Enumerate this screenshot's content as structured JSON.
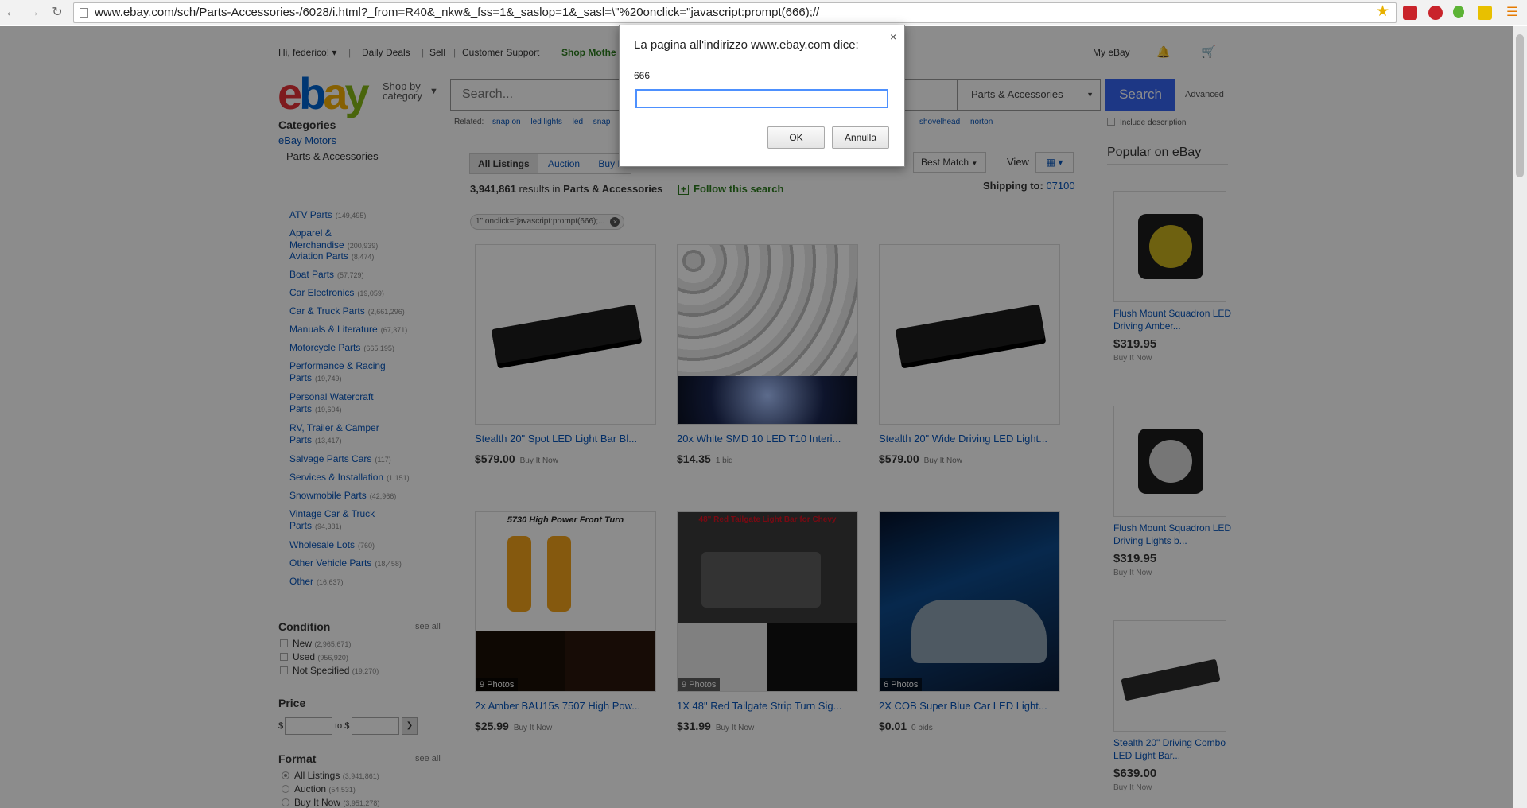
{
  "browser": {
    "url": "www.ebay.com/sch/Parts-Accessories-/6028/i.html?_from=R40&_nkw&_fss=1&_saslop=1&_sasl=\\\"%20onclick=\"javascript:prompt(666);//"
  },
  "header": {
    "greeting": "Hi, federico!",
    "daily_deals": "Daily Deals",
    "sell": "Sell",
    "customer_support": "Customer Support",
    "shop_mothers": "Shop Mothe",
    "my_ebay": "My eBay",
    "shop_by_category": "Shop by\ncategory",
    "search_placeholder": "Search...",
    "category_selected": "Parts & Accessories",
    "search_button": "Search",
    "advanced": "Advanced",
    "include_description": "Include description",
    "related_label": "Related:",
    "related": [
      "snap on",
      "led lights",
      "led",
      "snap"
    ],
    "related_right": [
      "shovelhead",
      "norton"
    ]
  },
  "sidebar": {
    "categories_heading": "Categories",
    "ebay_motors": "eBay Motors",
    "parts_accessories": "Parts & Accessories",
    "items": [
      {
        "label": "ATV Parts",
        "count": "(149,495)"
      },
      {
        "label": "Apparel &\nMerchandise",
        "count": "(200,939)"
      },
      {
        "label": "Aviation Parts",
        "count": "(8,474)"
      },
      {
        "label": "Boat Parts",
        "count": "(57,729)"
      },
      {
        "label": "Car Electronics",
        "count": "(19,059)"
      },
      {
        "label": "Car & Truck Parts",
        "count": "(2,661,296)"
      },
      {
        "label": "Manuals & Literature",
        "count": "(67,371)"
      },
      {
        "label": "Motorcycle Parts",
        "count": "(665,195)"
      },
      {
        "label": "Performance & Racing\nParts",
        "count": "(19,749)"
      },
      {
        "label": "Personal Watercraft\nParts",
        "count": "(19,604)"
      },
      {
        "label": "RV, Trailer & Camper\nParts",
        "count": "(13,417)"
      },
      {
        "label": "Salvage Parts Cars",
        "count": "(117)"
      },
      {
        "label": "Services & Installation",
        "count": "(1,151)"
      },
      {
        "label": "Snowmobile Parts",
        "count": "(42,966)"
      },
      {
        "label": "Vintage Car & Truck\nParts",
        "count": "(94,381)"
      },
      {
        "label": "Wholesale Lots",
        "count": "(760)"
      },
      {
        "label": "Other Vehicle Parts",
        "count": "(18,458)"
      },
      {
        "label": "Other",
        "count": "(16,637)"
      }
    ],
    "condition_heading": "Condition",
    "see_all": "see all",
    "conditions": [
      {
        "label": "New",
        "count": "(2,965,671)"
      },
      {
        "label": "Used",
        "count": "(956,920)"
      },
      {
        "label": "Not Specified",
        "count": "(19,270)"
      }
    ],
    "price_heading": "Price",
    "currency": "$",
    "to_label": "to $",
    "format_heading": "Format",
    "formats": [
      {
        "label": "All Listings",
        "count": "(3,941,861)"
      },
      {
        "label": "Auction",
        "count": "(54,531)"
      },
      {
        "label": "Buy It Now",
        "count": "(3,951,278)"
      }
    ]
  },
  "results": {
    "tabs": [
      "All Listings",
      "Auction",
      "Buy It"
    ],
    "sort": "Best Match",
    "view_label": "View",
    "count": "3,941,861",
    "results_in": "results in",
    "category": "Parts & Accessories",
    "follow": "Follow this search",
    "shipping_label": "Shipping to:",
    "shipping_zip": "07100",
    "filter_chip": "1\" onclick=\"javascript:prompt(666);...",
    "items": [
      {
        "title": "Stealth 20\" Spot LED Light Bar Bl...",
        "price": "$579.00",
        "sub": "Buy It Now",
        "photos": ""
      },
      {
        "title": "20x White SMD 10 LED T10 Interi...",
        "price": "$14.35",
        "sub": "1 bid",
        "photos": ""
      },
      {
        "title": "Stealth 20\" Wide Driving LED Light...",
        "price": "$579.00",
        "sub": "Buy It Now",
        "photos": ""
      },
      {
        "title": "2x Amber BAU15s 7507 High Pow...",
        "price": "$25.99",
        "sub": "Buy It Now",
        "photos": "9 Photos"
      },
      {
        "title": "1X 48\" Red Tailgate Strip Turn Sig...",
        "price": "$31.99",
        "sub": "Buy It Now",
        "photos": "9 Photos"
      },
      {
        "title": "2X COB Super Blue Car LED Light...",
        "price": "$0.01",
        "sub": "0 bids",
        "photos": "6 Photos"
      }
    ],
    "tile4_banner": "5730 High Power Front Turn",
    "tile5_banner": "48\" Red Tailgate Light Bar for Chevy"
  },
  "popular": {
    "heading": "Popular on eBay",
    "items": [
      {
        "title": "Flush Mount Squadron LED Driving Amber...",
        "price": "$319.95",
        "sub": "Buy It Now"
      },
      {
        "title": "Flush Mount Squadron LED Driving Lights b...",
        "price": "$319.95",
        "sub": "Buy It Now"
      },
      {
        "title": "Stealth 20\" Driving Combo LED Light Bar...",
        "price": "$639.00",
        "sub": "Buy It Now"
      }
    ]
  },
  "dialog": {
    "title": "La pagina all'indirizzo www.ebay.com dice:",
    "message": "666",
    "input_value": "",
    "ok": "OK",
    "cancel": "Annulla",
    "close": "×"
  }
}
